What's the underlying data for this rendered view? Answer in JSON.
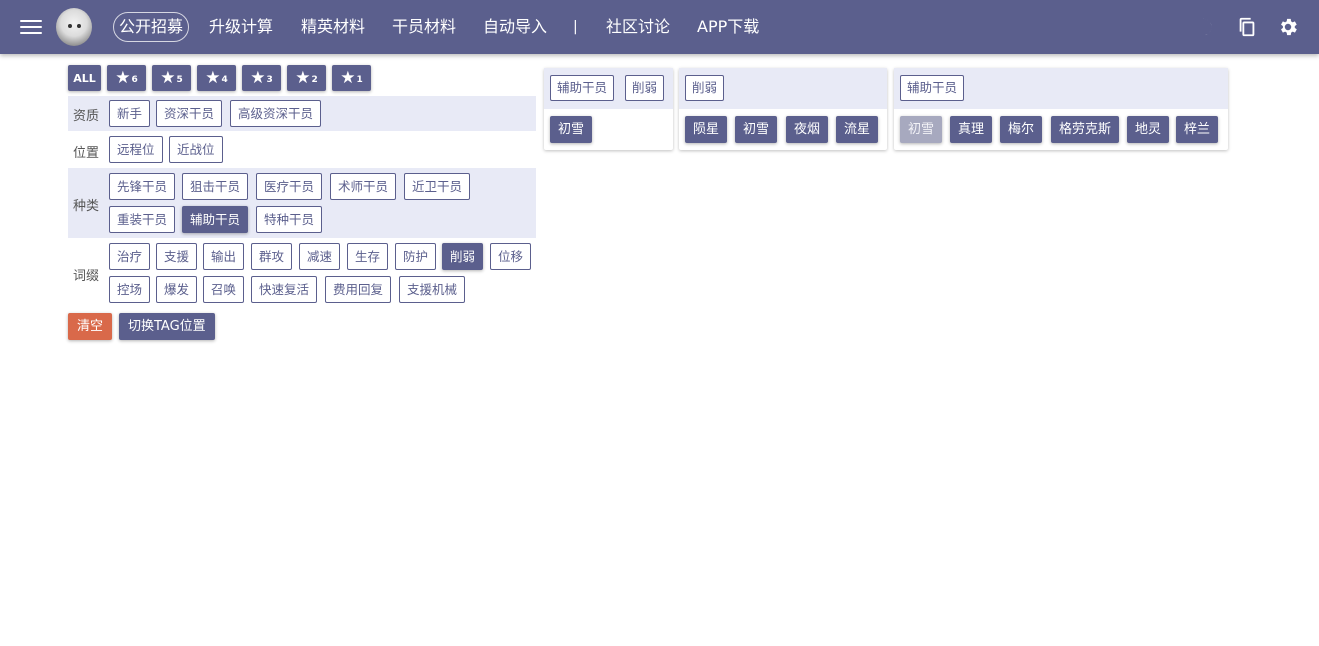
{
  "nav": {
    "items": [
      "公开招募",
      "升级计算",
      "精英材料",
      "干员材料",
      "自动导入",
      "社区讨论",
      "APP下载"
    ],
    "separator": "|",
    "icons": [
      "menu-icon",
      "moon-icon",
      "copy-icon",
      "gear-icon"
    ]
  },
  "rarity": {
    "all": "ALL",
    "star_glyph": "★",
    "levels": [
      "6",
      "5",
      "4",
      "3",
      "2",
      "1"
    ]
  },
  "filters": {
    "qualification": {
      "label": "资质",
      "tags": [
        "新手",
        "资深干员",
        "高级资深干员"
      ]
    },
    "position": {
      "label": "位置",
      "tags": [
        "远程位",
        "近战位"
      ]
    },
    "class": {
      "label": "种类",
      "tags": [
        "先锋干员",
        "狙击干员",
        "医疗干员",
        "术师干员",
        "近卫干员",
        "重装干员",
        "辅助干员",
        "特种干员"
      ],
      "selected": "辅助干员"
    },
    "affix": {
      "label": "词缀",
      "tags": [
        "治疗",
        "支援",
        "输出",
        "群攻",
        "减速",
        "生存",
        "防护",
        "削弱",
        "位移",
        "控场",
        "爆发",
        "召唤",
        "快速复活",
        "费用回复",
        "支援机械"
      ],
      "selected": "削弱"
    }
  },
  "actions": {
    "clear": "清空",
    "switch": "切换TAG位置"
  },
  "results": [
    {
      "tags": [
        "辅助干员",
        "削弱"
      ],
      "operators": [
        "初雪"
      ]
    },
    {
      "tags": [
        "削弱"
      ],
      "operators": [
        "陨星",
        "初雪",
        "夜烟",
        "流星"
      ]
    },
    {
      "tags": [
        "辅助干员"
      ],
      "operators": [
        "初雪",
        "真理",
        "梅尔",
        "格劳克斯",
        "地灵",
        "梓兰"
      ],
      "dimmed": [
        "初雪"
      ]
    }
  ],
  "colors": {
    "primary": "#5b5f8d",
    "band": "#e8eaf6",
    "clear": "#d9694a",
    "dim": "#a7a9bf"
  }
}
